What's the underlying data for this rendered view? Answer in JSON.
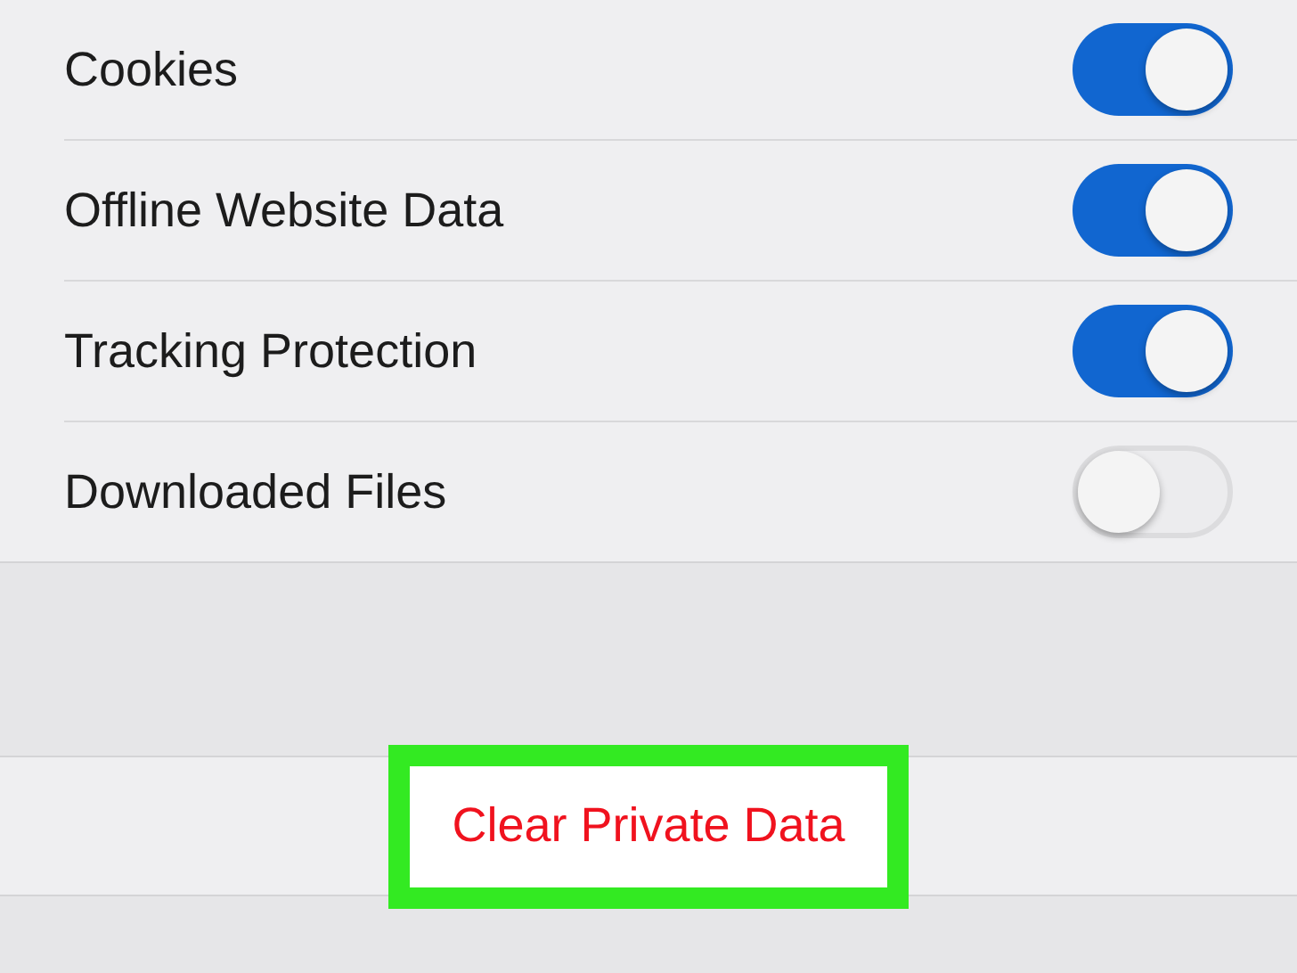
{
  "settings": [
    {
      "label": "Cookies",
      "on": true
    },
    {
      "label": "Offline Website Data",
      "on": true
    },
    {
      "label": "Tracking Protection",
      "on": true
    },
    {
      "label": "Downloaded Files",
      "on": false
    }
  ],
  "clear_button": {
    "label": "Clear Private Data",
    "highlighted": true
  }
}
